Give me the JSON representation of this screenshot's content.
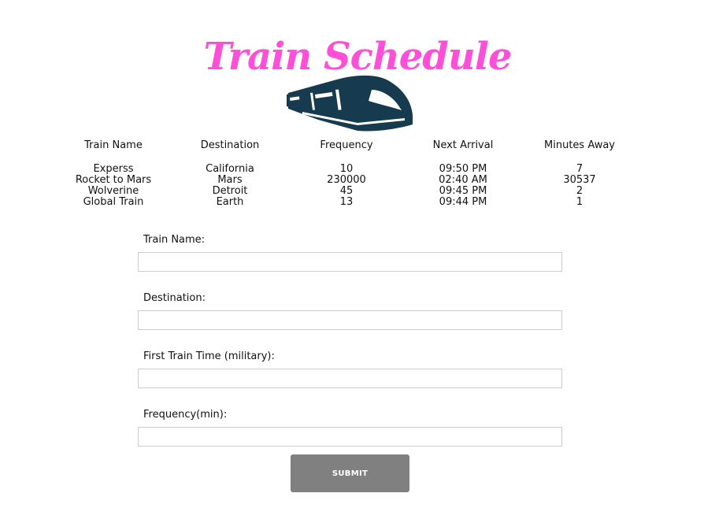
{
  "colors": {
    "title": "#ff4fd8",
    "logo": "#163a4e",
    "button_bg": "#808080",
    "button_text": "#ffffff"
  },
  "header": {
    "title": "Train Schedule",
    "logo_icon": "train-icon"
  },
  "schedule": {
    "columns": [
      "Train Name",
      "Destination",
      "Frequency",
      "Next Arrival",
      "Minutes Away"
    ],
    "rows": [
      [
        "Experss",
        "California",
        "10",
        "09:50 PM",
        "7"
      ],
      [
        "Rocket to Mars",
        "Mars",
        "230000",
        "02:40 AM",
        "30537"
      ],
      [
        "Wolverine",
        "Detroit",
        "45",
        "09:45 PM",
        "2"
      ],
      [
        "Global Train",
        "Earth",
        "13",
        "09:44 PM",
        "1"
      ]
    ]
  },
  "form": {
    "train_name_label": "Train Name:",
    "train_name_value": "",
    "destination_label": "Destination:",
    "destination_value": "",
    "first_time_label": "First Train Time (military):",
    "first_time_value": "",
    "frequency_label": "Frequency(min):",
    "frequency_value": "",
    "submit_label": "SUBMIT"
  }
}
